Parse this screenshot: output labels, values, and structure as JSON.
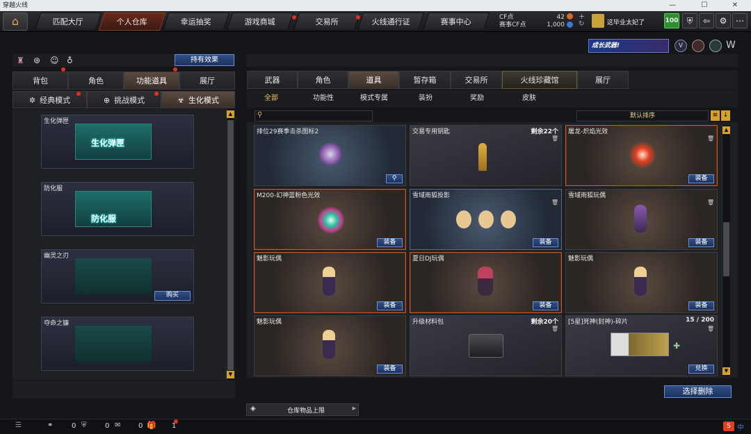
{
  "window": {
    "title": "穿越火线",
    "min": "—",
    "max": "☐",
    "close": "✕"
  },
  "topnav": {
    "tabs": [
      "匹配大厅",
      "个人仓库",
      "幸运抽奖",
      "游戏商城",
      "交易所",
      "火线通行证",
      "赛事中心"
    ],
    "cf_label": "CF点",
    "cf_value": "42",
    "event_cf_label": "赛事CF点",
    "event_cf_value": "1,000",
    "username": "这毕业太妃了",
    "level": "100",
    "icons": [
      "home-icon",
      "shield-icon",
      "exit-icon",
      "gear-icon",
      "menu-icon"
    ]
  },
  "left": {
    "effect_button": "持有效果",
    "tabs": [
      "背包",
      "角色",
      "功能道具",
      "展厅"
    ],
    "modes": [
      "经典模式",
      "挑战模式",
      "生化模式"
    ],
    "items": [
      {
        "name": "生化弹匣",
        "title": "生化弹匣",
        "button": ""
      },
      {
        "name": "防化服",
        "title": "防化服",
        "button": ""
      },
      {
        "name": "幽灵之刃",
        "title": "",
        "button": "购买"
      },
      {
        "name": "夺命之镰",
        "title": "",
        "button": ""
      }
    ]
  },
  "right": {
    "banner": "成长武器!",
    "tabs": [
      "武器",
      "角色",
      "道具",
      "暂存箱",
      "交易所",
      "火线珍藏馆",
      "展厅"
    ],
    "subtabs": [
      "全部",
      "功能性",
      "模式专属",
      "装扮",
      "奖励",
      "皮肤"
    ],
    "search_placeholder": "",
    "sort": "默认排序",
    "equip": "装备",
    "exchange": "兑换",
    "items": [
      {
        "name": "排位29赛季击杀图标2",
        "count": ""
      },
      {
        "name": "交易专用钥匙",
        "count": "剩余22个"
      },
      {
        "name": "屠龙-炽焰光效",
        "count": ""
      },
      {
        "name": "M200-幻神蓝粉色光效",
        "count": ""
      },
      {
        "name": "雪域雨狐投影",
        "count": ""
      },
      {
        "name": "雪域雨狐玩偶",
        "count": ""
      },
      {
        "name": "魅影玩偶",
        "count": ""
      },
      {
        "name": "夏日DJ玩偶",
        "count": ""
      },
      {
        "name": "魅影玩偶",
        "count": ""
      },
      {
        "name": "魅影玩偶",
        "count": ""
      },
      {
        "name": "升级材料包",
        "count": "剩余20个"
      },
      {
        "name": "[5星]死神(封神)-碎片",
        "count": "15 / 200"
      }
    ],
    "delete_button": "选择删除",
    "capacity": "仓库物品上限"
  },
  "bottom": {
    "counts": [
      "0",
      "0",
      "0",
      "1"
    ]
  }
}
